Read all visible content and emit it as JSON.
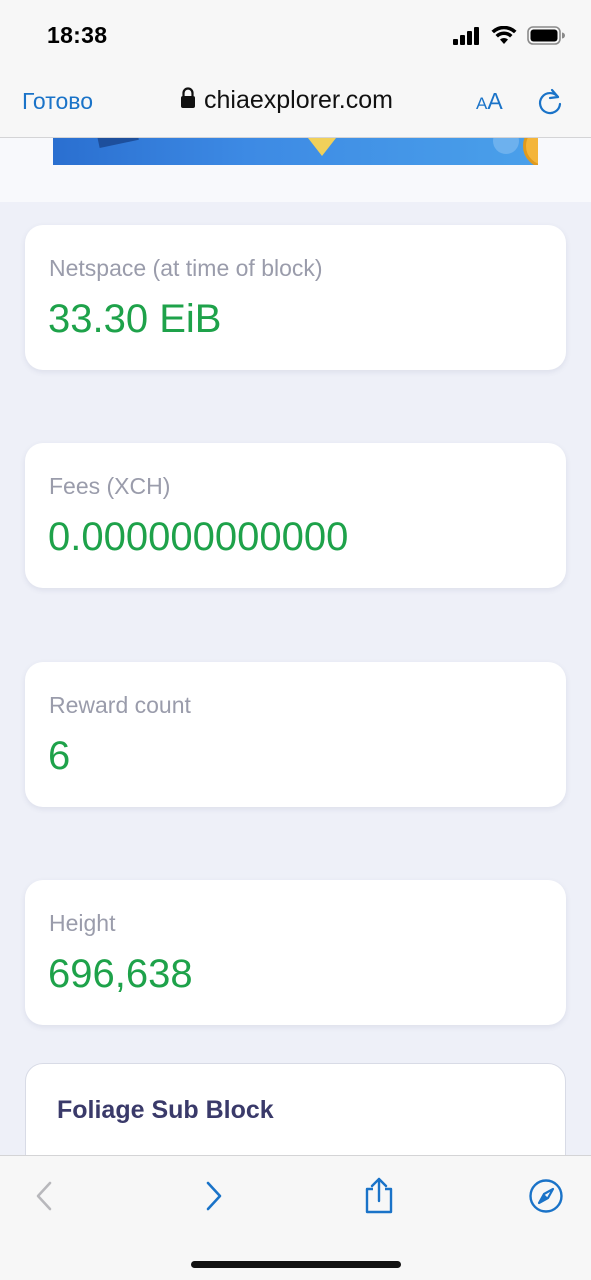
{
  "status": {
    "time": "18:38"
  },
  "browser": {
    "done_label": "Готово",
    "url": "chiaexplorer.com",
    "text_size_small": "A",
    "text_size_large": "A"
  },
  "cards": [
    {
      "label": "Netspace (at time of block)",
      "value": "33.30 EiB"
    },
    {
      "label": "Fees (XCH)",
      "value": "0.000000000000"
    },
    {
      "label": "Reward count",
      "value": "6"
    },
    {
      "label": "Height",
      "value": "696,638"
    }
  ],
  "section": {
    "title": "Foliage Sub Block"
  },
  "colors": {
    "accent": "#1a73c8",
    "value_green": "#1ea24a",
    "label_gray": "#9a9cab",
    "page_bg": "#eef0f8"
  },
  "icons": {
    "lock": "lock-icon",
    "reload": "reload-icon",
    "back": "back-chevron-icon",
    "forward": "forward-chevron-icon",
    "share": "share-icon",
    "compass": "compass-icon"
  }
}
